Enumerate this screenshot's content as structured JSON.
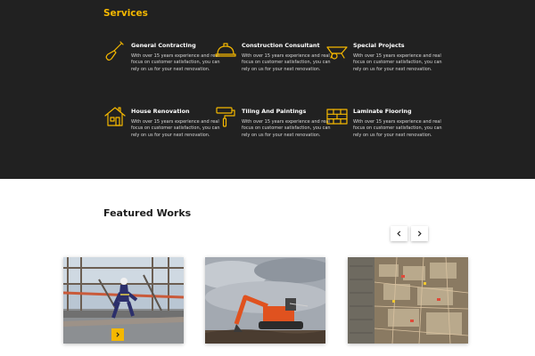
{
  "services": {
    "title": "Services",
    "accent_color": "#f5b800",
    "background_color": "#212121",
    "items": [
      {
        "icon": "shovel-icon",
        "title": "General Contracting",
        "description": "With over 15 years experience and real focus on customer satisfaction, you can rely on us for your next renovation."
      },
      {
        "icon": "hard-hat-icon",
        "title": "Construction Consultant",
        "description": "With over 15 years experience and real focus on customer satisfaction, you can rely on us for your next renovation."
      },
      {
        "icon": "wheelbarrow-icon",
        "title": "Special Projects",
        "description": "With over 15 years experience and real focus on customer satisfaction, you can rely on us for your next renovation."
      },
      {
        "icon": "house-icon",
        "title": "House Renovation",
        "description": "With over 15 years experience and real focus on customer satisfaction, you can rely on us for your next renovation."
      },
      {
        "icon": "paint-roller-icon",
        "title": "Tiling And Paintings",
        "description": "With over 15 years experience and real focus on customer satisfaction, you can rely on us for your next renovation."
      },
      {
        "icon": "brick-wall-icon",
        "title": "Laminate Flooring",
        "description": "With over 15 years experience and real focus on customer satisfaction, you can rely on us for your next renovation."
      }
    ]
  },
  "featured": {
    "title": "Featured Works",
    "prev_icon": "chevron-left-icon",
    "next_icon": "chevron-right-icon",
    "works": [
      {
        "image": "worker-on-scaffold-photo",
        "overlay_icon": "chevron-right-icon"
      },
      {
        "image": "orange-excavator-photo"
      },
      {
        "image": "construction-site-aerial-photo"
      }
    ]
  }
}
